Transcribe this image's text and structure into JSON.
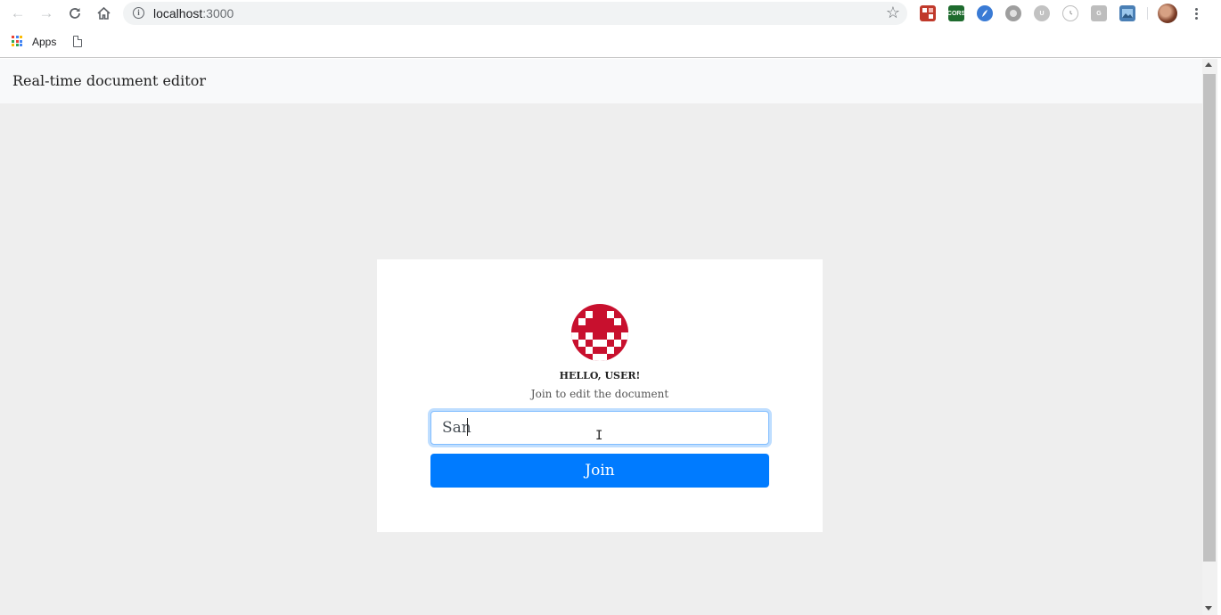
{
  "browser": {
    "url_host": "localhost",
    "url_port": ":3000",
    "bookmarks": {
      "apps_label": "Apps"
    },
    "extensions": [
      {
        "icon": "grid-extension-icon",
        "color": "#c0392b"
      },
      {
        "icon": "cors-extension-icon",
        "label": "CORS",
        "color": "#1e6b2e"
      },
      {
        "icon": "feather-extension-icon",
        "color": "#3a7bd5"
      },
      {
        "icon": "circle-extension-icon",
        "color": "#9e9e9e"
      },
      {
        "icon": "u-extension-icon",
        "label": "U",
        "color": "#c2c2c2"
      },
      {
        "icon": "timer-extension-icon",
        "color": "#d0d0d0"
      },
      {
        "icon": "g-extension-icon",
        "label": "G",
        "color": "#bdbdbd"
      },
      {
        "icon": "image-extension-icon",
        "color": "#4a7fb5"
      }
    ]
  },
  "app": {
    "brand": "Real-time document editor",
    "logo_color": "#c8102e",
    "greeting": "HELLO, USER!",
    "subtitle": "Join to edit the document",
    "name_input_value": "San",
    "join_label": "Join",
    "accent_color": "#007bff"
  }
}
